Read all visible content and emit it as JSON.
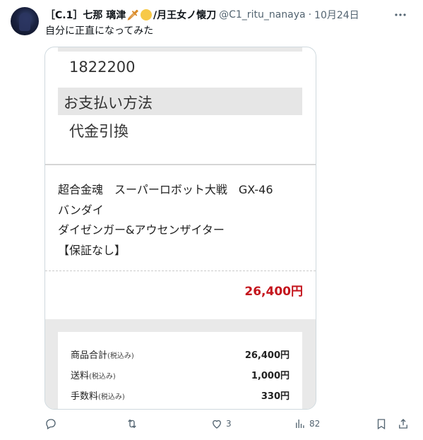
{
  "author": {
    "display_name_prefix": "［C.1］七那 璃津",
    "display_name_suffix": "/月王女ノ懐刀",
    "handle": "@C1_ritu_nanaya",
    "date": "10月24日"
  },
  "tweet_text": "自分に正直になってみた",
  "receipt": {
    "number": "1822200",
    "payment_heading": "お支払い方法",
    "payment_method": "代金引換",
    "product_lines": [
      "超合金魂　スーパーロボット大戦　GX-46",
      "バンダイ",
      "ダイゼンガー&アウセンザイター",
      "【保証なし】"
    ],
    "price": "26,400円",
    "summary": [
      {
        "label": "商品合計",
        "note": "(税込み)",
        "value": "26,400円"
      },
      {
        "label": "送料",
        "note": "(税込み)",
        "value": "1,000円"
      },
      {
        "label": "手数料",
        "note": "(税込み)",
        "value": "330円"
      }
    ]
  },
  "actions": {
    "reply_count": "",
    "retweet_count": "",
    "like_count": "3",
    "views_count": "82"
  },
  "icons": [
    "more-icon",
    "reply-icon",
    "retweet-icon",
    "like-icon",
    "views-icon",
    "bookmark-icon",
    "share-icon"
  ],
  "colors": {
    "price_red": "#c4141c",
    "muted": "#536471"
  }
}
